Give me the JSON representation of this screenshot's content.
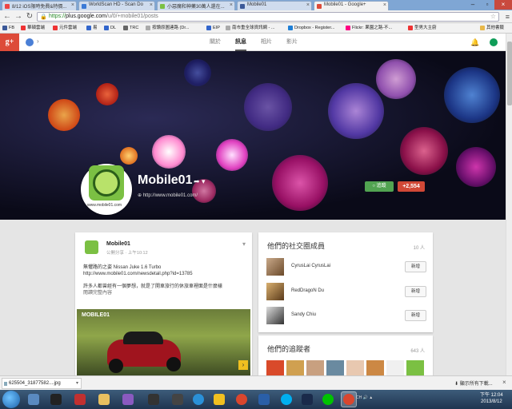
{
  "browser": {
    "tabs": [
      {
        "label": "8/12 iOS限時免費&特價..."
      },
      {
        "label": "WorldScan HD - Scan Do"
      },
      {
        "label": "小惡魔和神藥30萬人還在..."
      },
      {
        "label": "Mobile01"
      },
      {
        "label": "Mobile01 - Google+"
      }
    ],
    "url_scheme": "https://",
    "url_host": "plus.google.com",
    "url_path": "/u/0/+mobile01/posts",
    "bookmarks": [
      {
        "label": "FB"
      },
      {
        "label": "華碩雲端"
      },
      {
        "label": "元件雲端"
      },
      {
        "label": "易"
      },
      {
        "label": "DL"
      },
      {
        "label": "TRC"
      },
      {
        "label": "按讚原圖連路 (Dr..."
      },
      {
        "label": "EIP"
      },
      {
        "label": "南市重全球資訊網 - ..."
      },
      {
        "label": "Dropbox - Register..."
      },
      {
        "label": "Flickr: 果園之路-不..."
      },
      {
        "label": "型男大主廚"
      },
      {
        "label": "其他書籤"
      }
    ]
  },
  "gplus": {
    "logo": "g+",
    "nav": [
      {
        "label": "關於"
      },
      {
        "label": "訊息"
      },
      {
        "label": "相片"
      },
      {
        "label": "影片"
      }
    ]
  },
  "profile": {
    "name": "Mobile01",
    "avatar_caption": "www.mobile01.com",
    "link": "http://www.mobile01.com/",
    "follow_label": "追蹤",
    "follower_badge": "+2,554"
  },
  "post": {
    "author": "Mobile01",
    "meta": "公開分享 · 上午10:12",
    "line1": "無懼路的之姿 Nissan Juke 1.6 Turbo",
    "line2": "http://www.mobile01.com/newsdetail.php?id=13785",
    "line3": "許多人都曾經有一個夢想，就是了開車旅行的休旅車裡面是什麼樣",
    "readmore": "閱讀完整內容",
    "image_logo": "MOBILE01"
  },
  "members": {
    "title": "他們的社交圈成員",
    "count": "10 人",
    "items": [
      {
        "name": "CyrusLai CyrusLai",
        "button": "新增"
      },
      {
        "name": "RedDragoN Du",
        "button": "新增"
      },
      {
        "name": "Sandy Chiu",
        "button": "新增"
      }
    ]
  },
  "followers": {
    "title": "他們的追蹤者",
    "count": "643 人"
  },
  "download": {
    "filename": "625504_31877582....jpg",
    "show_all": "顯示所有下載..."
  },
  "taskbar": {
    "tray": "CH 🔊 ▲",
    "time": "下午 12:04",
    "date": "2013/8/12"
  },
  "colors": {
    "gplus_red": "#dd4b39",
    "follow_green": "#51a351",
    "badge_red": "#d14836"
  }
}
